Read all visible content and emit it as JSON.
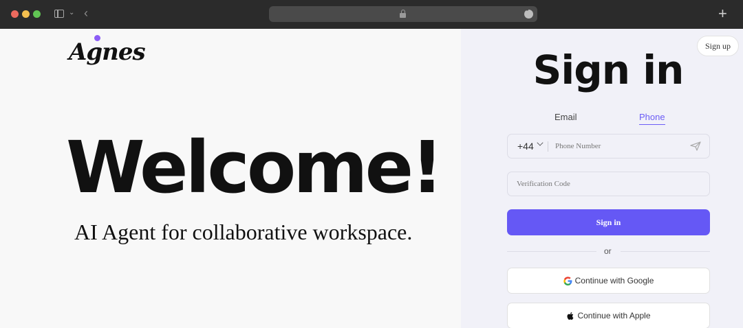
{
  "browser": {
    "icons": [
      "sidebar-icon",
      "chevron-down-icon",
      "back-icon",
      "lock-icon",
      "more-icon",
      "plus-icon"
    ],
    "new_tab_glyph": "+"
  },
  "brand": {
    "logo_text": "Agnes",
    "accent": "#8b5cf6"
  },
  "hero": {
    "headline": "Welcome!",
    "tagline": "AI Agent for collaborative workspace."
  },
  "auth": {
    "signup_label": "Sign up",
    "title": "Sign in",
    "tabs": [
      {
        "label": "Email",
        "active": false
      },
      {
        "label": "Phone",
        "active": true
      }
    ],
    "country_code": "+44",
    "phone_placeholder": "Phone Number",
    "code_placeholder": "Verification Code",
    "signin_label": "Sign in",
    "or_label": "or",
    "google_label": "Continue with Google",
    "apple_label": "Continue with Apple",
    "primary_color": "#6558f5"
  }
}
